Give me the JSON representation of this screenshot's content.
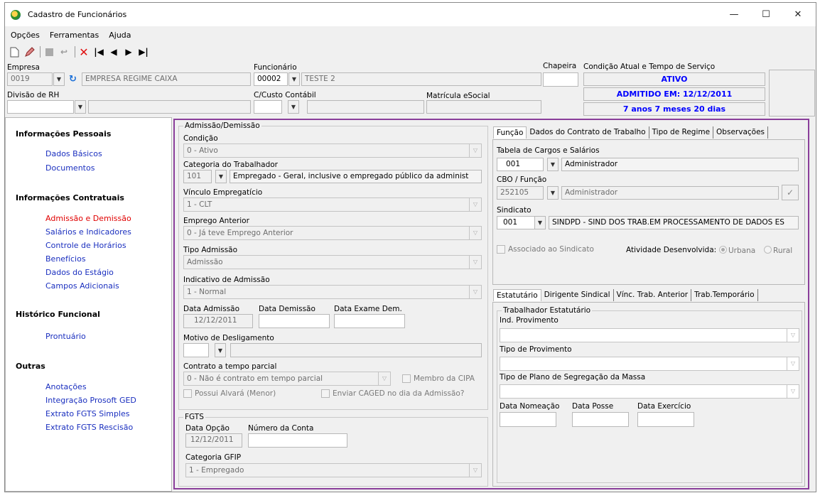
{
  "window": {
    "title": "Cadastro de Funcionários",
    "minimize": "—",
    "maximize": "☐",
    "close": "✕"
  },
  "menu": [
    "Opções",
    "Ferramentas",
    "Ajuda"
  ],
  "header": {
    "empresa_label": "Empresa",
    "empresa_code": "0019",
    "empresa_name": "EMPRESA REGIME CAIXA",
    "funcionario_label": "Funcionário",
    "funcionario_code": "00002",
    "funcionario_name": "TESTE 2",
    "chapeira_label": "Chapeira",
    "chapeira_value": "",
    "condicao_label": "Condição Atual e Tempo de Serviço",
    "status": "ATIVO",
    "admitido": "ADMITIDO EM: 12/12/2011",
    "tempo": "7 anos 7 meses 20 dias",
    "divisao_label": "Divisão de RH",
    "custo_label": "C/Custo Contábil",
    "matricula_label": "Matrícula eSocial"
  },
  "nav": {
    "sections": [
      {
        "title": "Informações Pessoais",
        "items": [
          "Dados Básicos",
          "Documentos"
        ]
      },
      {
        "title": "Informações Contratuais",
        "items": [
          "Admissão e Demissão",
          "Salários e Indicadores",
          "Controle de Horários",
          "Benefícios",
          "Dados do Estágio",
          "Campos Adicionais"
        ]
      },
      {
        "title": "Histórico Funcional",
        "items": [
          "Prontuário"
        ]
      },
      {
        "title": "Outras",
        "items": [
          "Anotações",
          "Integração Prosoft GED",
          "Extrato FGTS Simples",
          "Extrato FGTS Rescisão"
        ]
      }
    ]
  },
  "admissao": {
    "group_title": "Admissão/Demissão",
    "condicao_label": "Condição",
    "condicao_value": "0 - Ativo",
    "categoria_label": "Categoria do Trabalhador",
    "categoria_code": "101",
    "categoria_desc": "Empregado - Geral, inclusive o empregado público da administ",
    "vinculo_label": "Vínculo Empregatício",
    "vinculo_value": "1 - CLT",
    "emprego_label": "Emprego Anterior",
    "emprego_value": "0 - Já teve Emprego Anterior",
    "tipo_label": "Tipo Admissão",
    "tipo_value": "Admissão",
    "indicativo_label": "Indicativo de Admissão",
    "indicativo_value": "1 - Normal",
    "data_adm_label": "Data Admissão",
    "data_adm_value": "12/12/2011",
    "data_dem_label": "Data Demissão",
    "data_exame_label": "Data Exame Dem.",
    "motivo_label": "Motivo de Desligamento",
    "contrato_label": "Contrato a tempo parcial",
    "contrato_value": "0 - Não é contrato em tempo parcial",
    "cipa_label": "Membro da CIPA",
    "alvara_label": "Possui Alvará (Menor)",
    "caged_label": "Enviar CAGED no dia da Admissão?"
  },
  "fgts": {
    "group_title": "FGTS",
    "data_opcao_label": "Data Opção",
    "data_opcao_value": "12/12/2011",
    "conta_label": "Número da Conta",
    "gfip_label": "Categoria GFIP",
    "gfip_value": "1 - Empregado"
  },
  "tabs_top": [
    "Função",
    "Dados do Contrato de Trabalho",
    "Tipo de Regime",
    "Observações"
  ],
  "funcao": {
    "tabela_label": "Tabela de Cargos e Salários",
    "tabela_code": "001",
    "tabela_desc": "Administrador",
    "cbo_label": "CBO / Função",
    "cbo_code": "252105",
    "cbo_desc": "Administrador",
    "sindicato_label": "Sindicato",
    "sindicato_code": "001",
    "sindicato_desc": "SINDPD - SIND DOS TRAB.EM PROCESSAMENTO DE DADOS ES",
    "associado_label": "Associado ao Sindicato",
    "atividade_label": "Atividade Desenvolvida:",
    "urbana": "Urbana",
    "rural": "Rural"
  },
  "tabs_bottom": [
    "Estatutário",
    "Dirigente Sindical",
    "Vínc. Trab. Anterior",
    "Trab.Temporário"
  ],
  "estatutario": {
    "group_title": "Trabalhador Estatutário",
    "ind_label": "Ind. Provimento",
    "tipo_label": "Tipo de Provimento",
    "plano_label": "Tipo de Plano de Segregação da Massa",
    "nomeacao_label": "Data Nomeação",
    "posse_label": "Data Posse",
    "exercicio_label": "Data Exercício"
  }
}
